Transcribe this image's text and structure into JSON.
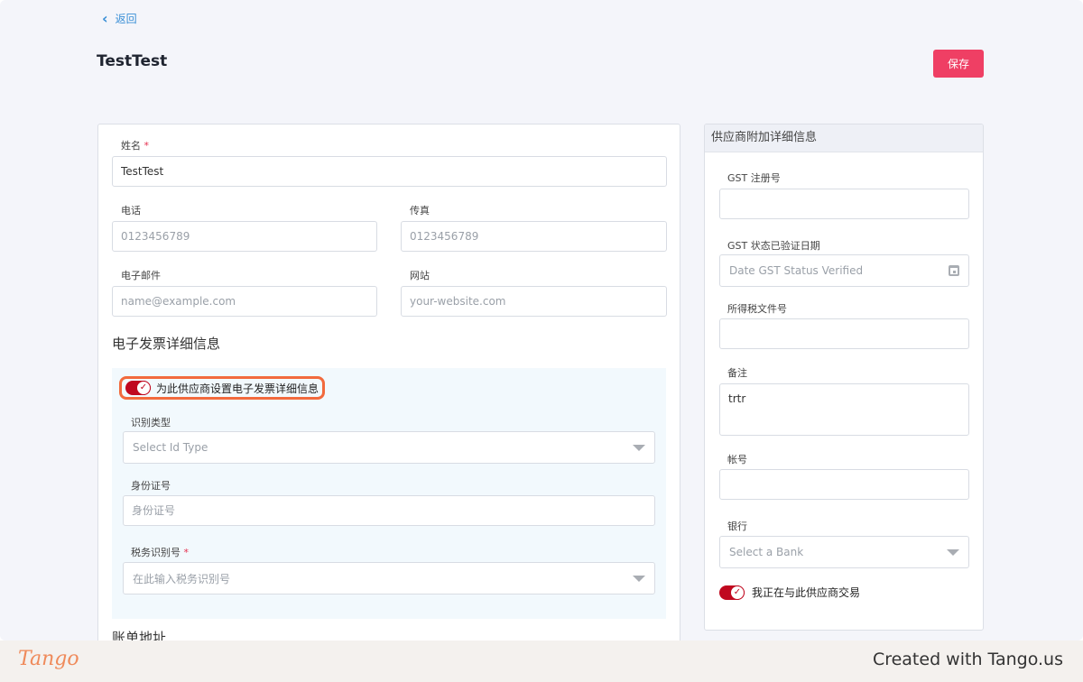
{
  "header": {
    "back_label": "返回",
    "title": "TestTest",
    "save_label": "保存"
  },
  "form": {
    "name_label": "姓名",
    "name_value": "TestTest",
    "phone_label": "电话",
    "phone_placeholder": "0123456789",
    "fax_label": "传真",
    "fax_placeholder": "0123456789",
    "email_label": "电子邮件",
    "email_placeholder": "name@example.com",
    "website_label": "网站",
    "website_placeholder": "your-website.com"
  },
  "einvoice": {
    "section_title": "电子发票详细信息",
    "toggle_label": "为此供应商设置电子发票详细信息",
    "toggle_on": true,
    "id_type_label": "识别类型",
    "id_type_placeholder": "Select Id Type",
    "id_number_label": "身份证号",
    "id_number_placeholder": "身份证号",
    "tax_id_label": "税务识别号",
    "tax_id_placeholder": "在此输入税务识别号"
  },
  "billing": {
    "title": "账单地址"
  },
  "side": {
    "title": "供应商附加详细信息",
    "gst_label": "GST 注册号",
    "gst_value": "",
    "gst_date_label": "GST 状态已验证日期",
    "gst_date_placeholder": "Date GST Status Verified",
    "income_tax_label": "所得税文件号",
    "income_tax_value": "",
    "notes_label": "备注",
    "notes_value": "trtr",
    "account_label": "帐号",
    "account_value": "",
    "bank_label": "银行",
    "bank_placeholder": "Select a Bank",
    "trading_label": "我正在与此供应商交易",
    "trading_on": true
  },
  "footer": {
    "logo": "Tango",
    "created_text": "Created with Tango.us"
  },
  "colors": {
    "accent": "#ef3f64",
    "toggle": "#c0081f",
    "highlight": "#f26a3d",
    "link": "#3a8fd6"
  }
}
